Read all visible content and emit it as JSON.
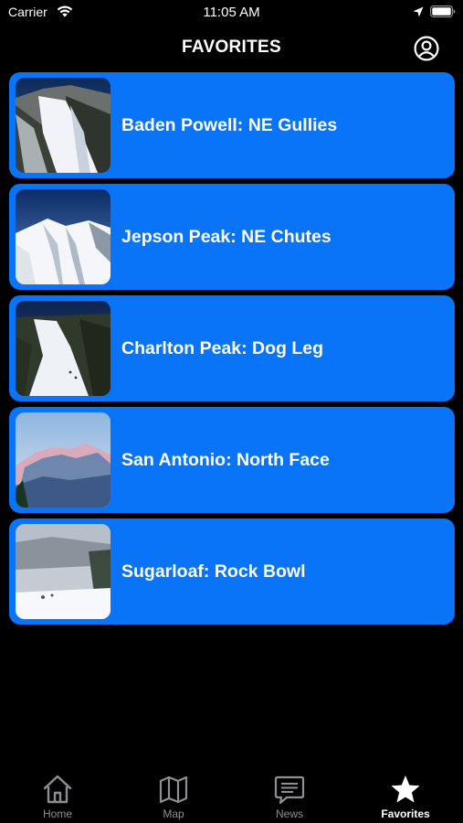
{
  "status_bar": {
    "carrier": "Carrier",
    "time": "11:05 AM",
    "icons": [
      "wifi-icon",
      "location-arrow-icon",
      "battery-icon"
    ]
  },
  "nav": {
    "title": "FAVORITES",
    "profile_icon": "user-circle-icon"
  },
  "favorites": [
    {
      "title": "Baden Powell: NE Gullies"
    },
    {
      "title": "Jepson Peak: NE Chutes"
    },
    {
      "title": "Charlton Peak: Dog Leg"
    },
    {
      "title": "San Antonio: North Face"
    },
    {
      "title": "Sugarloaf: Rock Bowl"
    }
  ],
  "tab_bar": {
    "tabs": [
      {
        "label": "Home",
        "icon": "home-icon",
        "active": false
      },
      {
        "label": "Map",
        "icon": "map-icon",
        "active": false
      },
      {
        "label": "News",
        "icon": "news-icon",
        "active": false
      },
      {
        "label": "Favorites",
        "icon": "star-icon",
        "active": true
      }
    ]
  },
  "colors": {
    "background": "#000000",
    "card": "#0a74f8",
    "tab_inactive": "#8e8e93",
    "tab_active": "#ffffff"
  }
}
